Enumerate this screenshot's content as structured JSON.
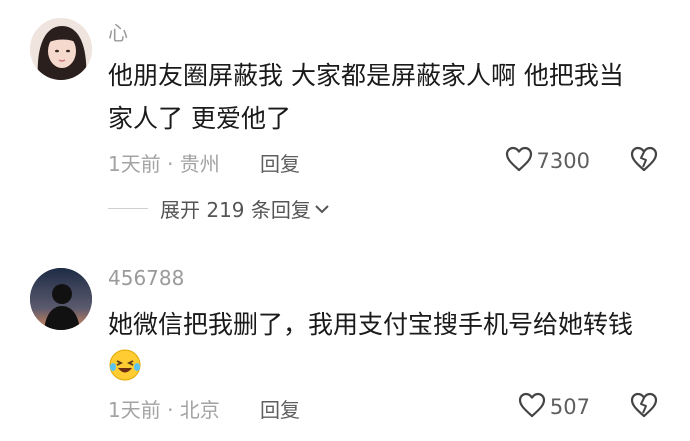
{
  "comments": [
    {
      "username": "心",
      "text_lines": [
        "他朋友圈屏蔽我 大家都是屏蔽家人啊 他把我当",
        "家人了 更爱他了"
      ],
      "time_location": "1天前 · 贵州",
      "reply_label": "回复",
      "likes": "7300",
      "expand_label": "展开 219 条回复"
    },
    {
      "username": "456788",
      "text_lines": [
        "她微信把我删了，我用支付宝搜手机号给她转钱"
      ],
      "emoji": "crying-laughing-emoji",
      "time_location": "1天前 · 北京",
      "reply_label": "回复",
      "likes": "507"
    }
  ]
}
